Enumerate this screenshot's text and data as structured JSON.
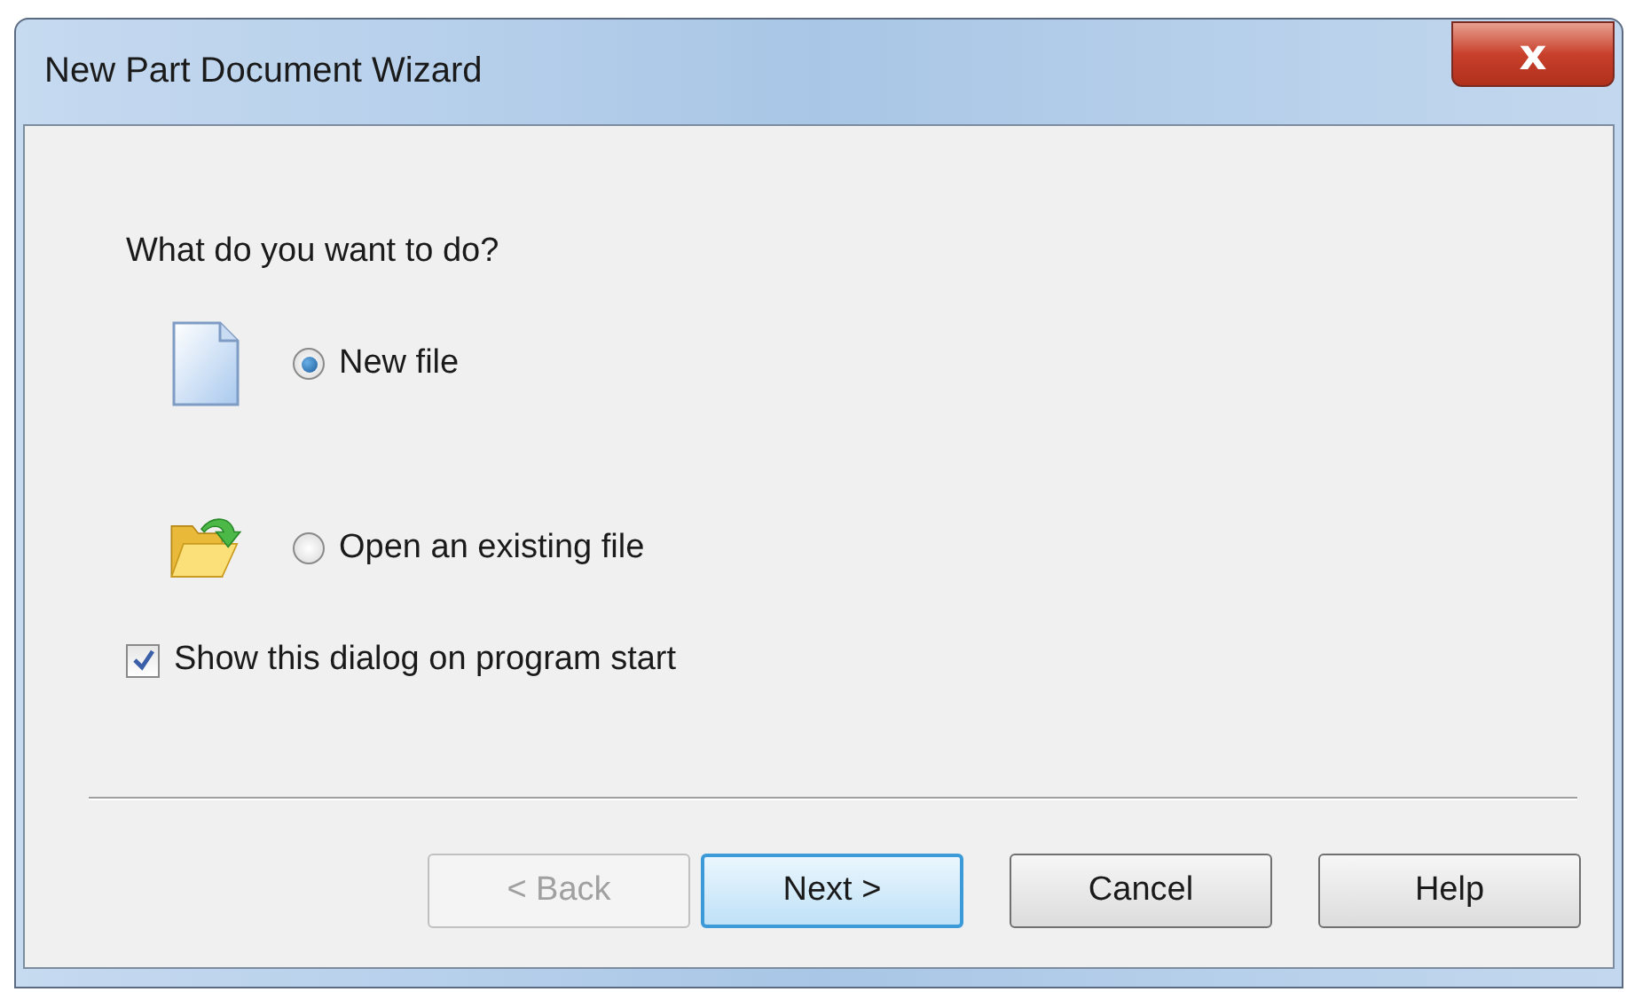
{
  "window": {
    "title": "New Part Document Wizard",
    "close": "x"
  },
  "question": "What do you want to do?",
  "options": [
    {
      "kind": "new",
      "label": "New file",
      "selected": true
    },
    {
      "kind": "open",
      "label": "Open an existing file",
      "selected": false
    }
  ],
  "show_on_start": {
    "label": "Show this dialog on program start",
    "checked": true
  },
  "buttons": [
    {
      "label": "< Back",
      "disabled": true,
      "default": false
    },
    {
      "label": "Next >",
      "disabled": false,
      "default": true
    },
    {
      "label": "Cancel",
      "disabled": false,
      "default": false
    },
    {
      "label": "Help",
      "disabled": false,
      "default": false
    }
  ]
}
